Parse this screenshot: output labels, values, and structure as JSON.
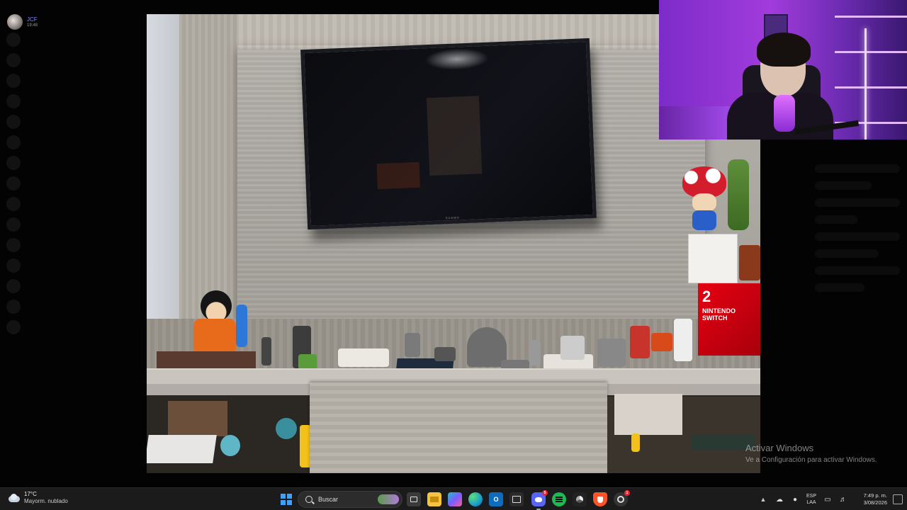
{
  "discord": {
    "user": {
      "name": "JCF",
      "time": "19:48"
    }
  },
  "stream": {
    "tv_brand": "SUMMO"
  },
  "switch_box": {
    "number": "2",
    "label_line1": "NINTENDO",
    "label_line2": "SWITCH"
  },
  "watermark": {
    "title": "Activar Windows",
    "subtitle": "Ve a Configuración para activar Windows."
  },
  "taskbar": {
    "weather": {
      "temp": "17°C",
      "condition": "Mayorm. nublado"
    },
    "search_placeholder": "Buscar",
    "apps": [
      {
        "name": "task-view",
        "icon": "task-view-icon",
        "color": "#3a3a3a"
      },
      {
        "name": "file-explorer",
        "icon": "folder-icon",
        "color": "#f5c242"
      },
      {
        "name": "copilot",
        "icon": "copilot-icon",
        "color": "#7a5cff"
      },
      {
        "name": "edge",
        "icon": "edge-icon",
        "color": "#1aa0c8"
      },
      {
        "name": "outlook",
        "icon": "outlook-icon",
        "color": "#0f6cbd"
      },
      {
        "name": "store",
        "icon": "store-icon",
        "color": "#2b2b2b"
      },
      {
        "name": "discord",
        "icon": "discord-icon",
        "color": "#5865f2",
        "badge": "5"
      },
      {
        "name": "spotify",
        "icon": "spotify-icon",
        "color": "#1db954"
      },
      {
        "name": "obs",
        "icon": "obs-icon",
        "color": "#222"
      },
      {
        "name": "brave",
        "icon": "brave-icon",
        "color": "#fb542b"
      },
      {
        "name": "browser",
        "icon": "browser-icon",
        "color": "#333",
        "badge": "1"
      }
    ],
    "tray": {
      "lang_1": "ESP",
      "lang_2": "LAA",
      "time": "7:49 p. m.",
      "date": "3/08/2026"
    }
  },
  "colors": {
    "start_blue": "#3fa0ff",
    "webcam_purple": "#a23bdc",
    "discord_blurple": "#5865f2"
  }
}
